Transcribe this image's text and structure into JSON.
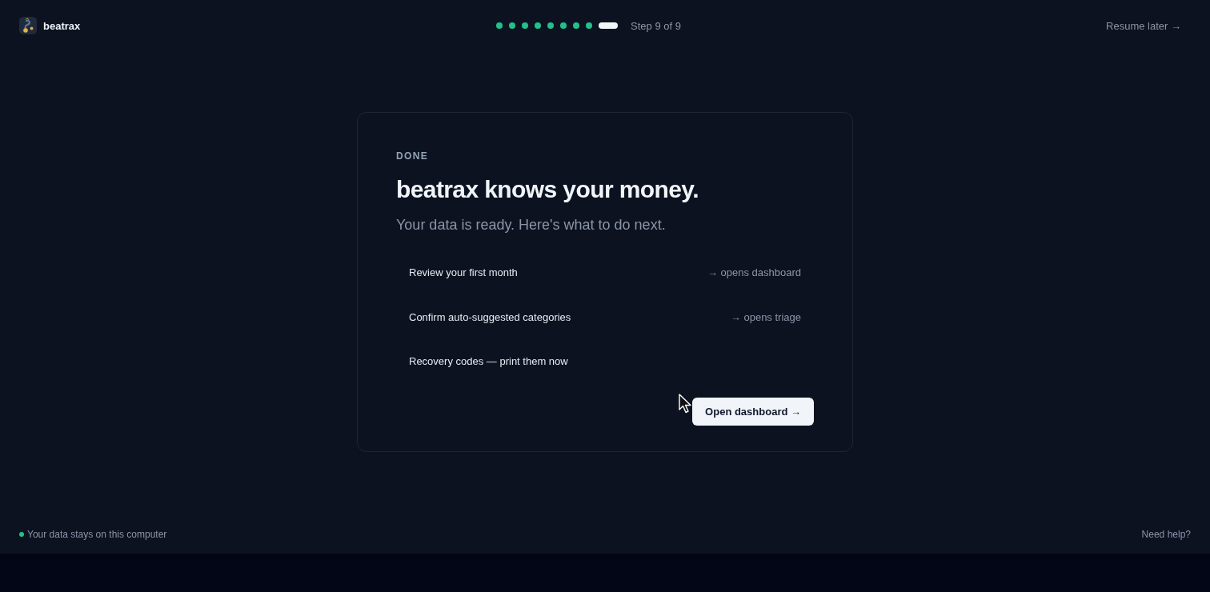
{
  "header": {
    "brand": "beatrax",
    "progress": {
      "steps": [
        {
          "current": false
        },
        {
          "current": false
        },
        {
          "current": false
        },
        {
          "current": false
        },
        {
          "current": false
        },
        {
          "current": false
        },
        {
          "current": false
        },
        {
          "current": false
        },
        {
          "current": true
        }
      ],
      "label": "Step 9 of 9"
    },
    "resume_link": "Resume later →"
  },
  "card": {
    "eyebrow": "DONE",
    "title": "beatrax knows your money.",
    "subtitle": "Your data is ready. Here's what to do next.",
    "actions": [
      {
        "label": "Review your first month",
        "hint": "→ opens dashboard"
      },
      {
        "label": "Confirm auto-suggested categories",
        "hint": "→ opens triage"
      },
      {
        "label": "Recovery codes — print them now"
      }
    ],
    "primary_button": "Open dashboard →"
  },
  "footer": {
    "privacy_note": "Your data stays on this computer",
    "help_link": "Need help?"
  }
}
